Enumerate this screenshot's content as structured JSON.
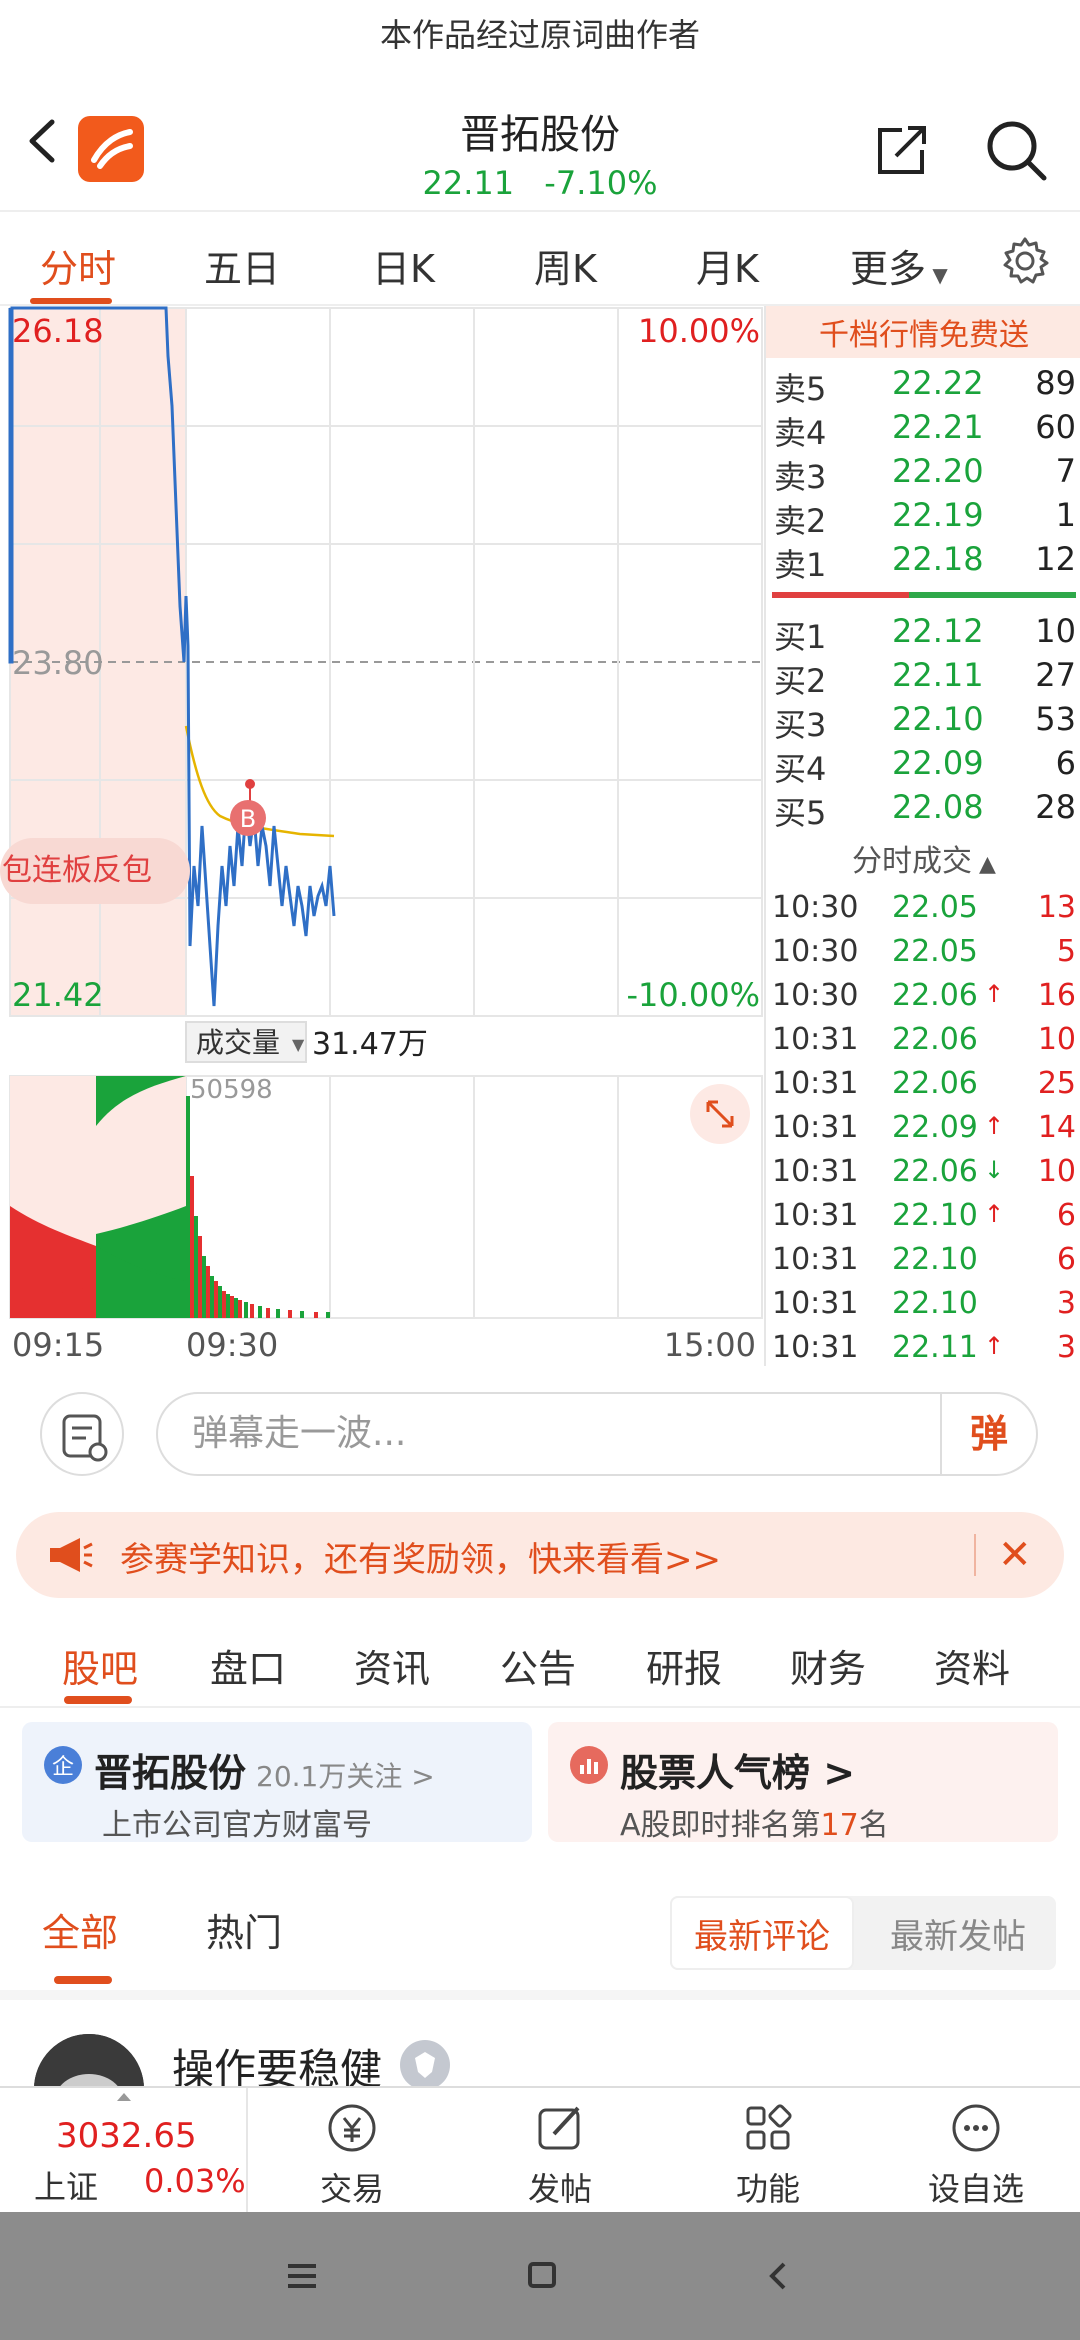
{
  "caption": "本作品经过原词曲作者",
  "header": {
    "title": "晋拓股份",
    "price": "22.11",
    "change_pct": "-7.10%"
  },
  "chart_tabs": [
    "分时",
    "五日",
    "日K",
    "周K",
    "月K",
    "更多"
  ],
  "chart_labels": {
    "high_price": "26.18",
    "mid_price": "23.80",
    "low_price": "21.42",
    "high_pct": "10.00%",
    "low_pct": "-10.00%",
    "buy_marker": "B",
    "promo_tag": "包连板反包",
    "volume_label": "成交量",
    "volume_value": "31.47万",
    "volume_max": "50598",
    "time_start": "09:15",
    "time_mid": "09:30",
    "time_end": "15:00"
  },
  "orderbook": {
    "ad": "千档行情免费送",
    "asks": [
      {
        "label": "卖5",
        "price": "22.22",
        "vol": "89"
      },
      {
        "label": "卖4",
        "price": "22.21",
        "vol": "60"
      },
      {
        "label": "卖3",
        "price": "22.20",
        "vol": "7"
      },
      {
        "label": "卖2",
        "price": "22.19",
        "vol": "1"
      },
      {
        "label": "卖1",
        "price": "22.18",
        "vol": "12"
      }
    ],
    "bids": [
      {
        "label": "买1",
        "price": "22.12",
        "vol": "10"
      },
      {
        "label": "买2",
        "price": "22.11",
        "vol": "27"
      },
      {
        "label": "买3",
        "price": "22.10",
        "vol": "53"
      },
      {
        "label": "买4",
        "price": "22.09",
        "vol": "6"
      },
      {
        "label": "买5",
        "price": "22.08",
        "vol": "28"
      }
    ],
    "trades_title": "分时成交",
    "trades": [
      {
        "time": "10:30",
        "price": "22.05",
        "arrow": "",
        "vol": "13"
      },
      {
        "time": "10:30",
        "price": "22.05",
        "arrow": "",
        "vol": "5"
      },
      {
        "time": "10:30",
        "price": "22.06",
        "arrow": "↑",
        "vol": "16"
      },
      {
        "time": "10:31",
        "price": "22.06",
        "arrow": "",
        "vol": "10"
      },
      {
        "time": "10:31",
        "price": "22.06",
        "arrow": "",
        "vol": "25"
      },
      {
        "time": "10:31",
        "price": "22.09",
        "arrow": "↑",
        "vol": "14"
      },
      {
        "time": "10:31",
        "price": "22.06",
        "arrow": "↓",
        "vol": "10"
      },
      {
        "time": "10:31",
        "price": "22.10",
        "arrow": "↑",
        "vol": "6"
      },
      {
        "time": "10:31",
        "price": "22.10",
        "arrow": "",
        "vol": "6"
      },
      {
        "time": "10:31",
        "price": "22.10",
        "arrow": "",
        "vol": "3"
      },
      {
        "time": "10:31",
        "price": "22.11",
        "arrow": "↑",
        "vol": "3"
      }
    ]
  },
  "danmu": {
    "placeholder": "弹幕走一波...",
    "send": "弹"
  },
  "promo": "参赛学知识，还有奖励领，快来看看>>",
  "section_tabs": [
    "股吧",
    "盘口",
    "资讯",
    "公告",
    "研报",
    "财务",
    "资料"
  ],
  "cards": [
    {
      "badge": "企",
      "name": "晋拓股份",
      "extra": "20.1万关注 >",
      "sub": "上市公司官方财富号"
    },
    {
      "name": "股票人气榜 >",
      "sub_prefix": "A股即时排名第",
      "rank": "17",
      "sub_suffix": "名"
    }
  ],
  "filter": {
    "tabs": [
      "全部",
      "热门"
    ],
    "sorts": [
      "最新评论",
      "最新发帖"
    ]
  },
  "post": {
    "user": "操作要稳健"
  },
  "bottom_nav": {
    "index_value": "3032.65",
    "index_name": "上证",
    "index_pct": "0.03%",
    "items": [
      "交易",
      "发帖",
      "功能",
      "设自选"
    ]
  },
  "colors": {
    "accent": "#e04e1d",
    "up": "#e02020",
    "down": "#1aa33b",
    "price_line": "#2f6fc6",
    "avg_line": "#e6b400"
  }
}
